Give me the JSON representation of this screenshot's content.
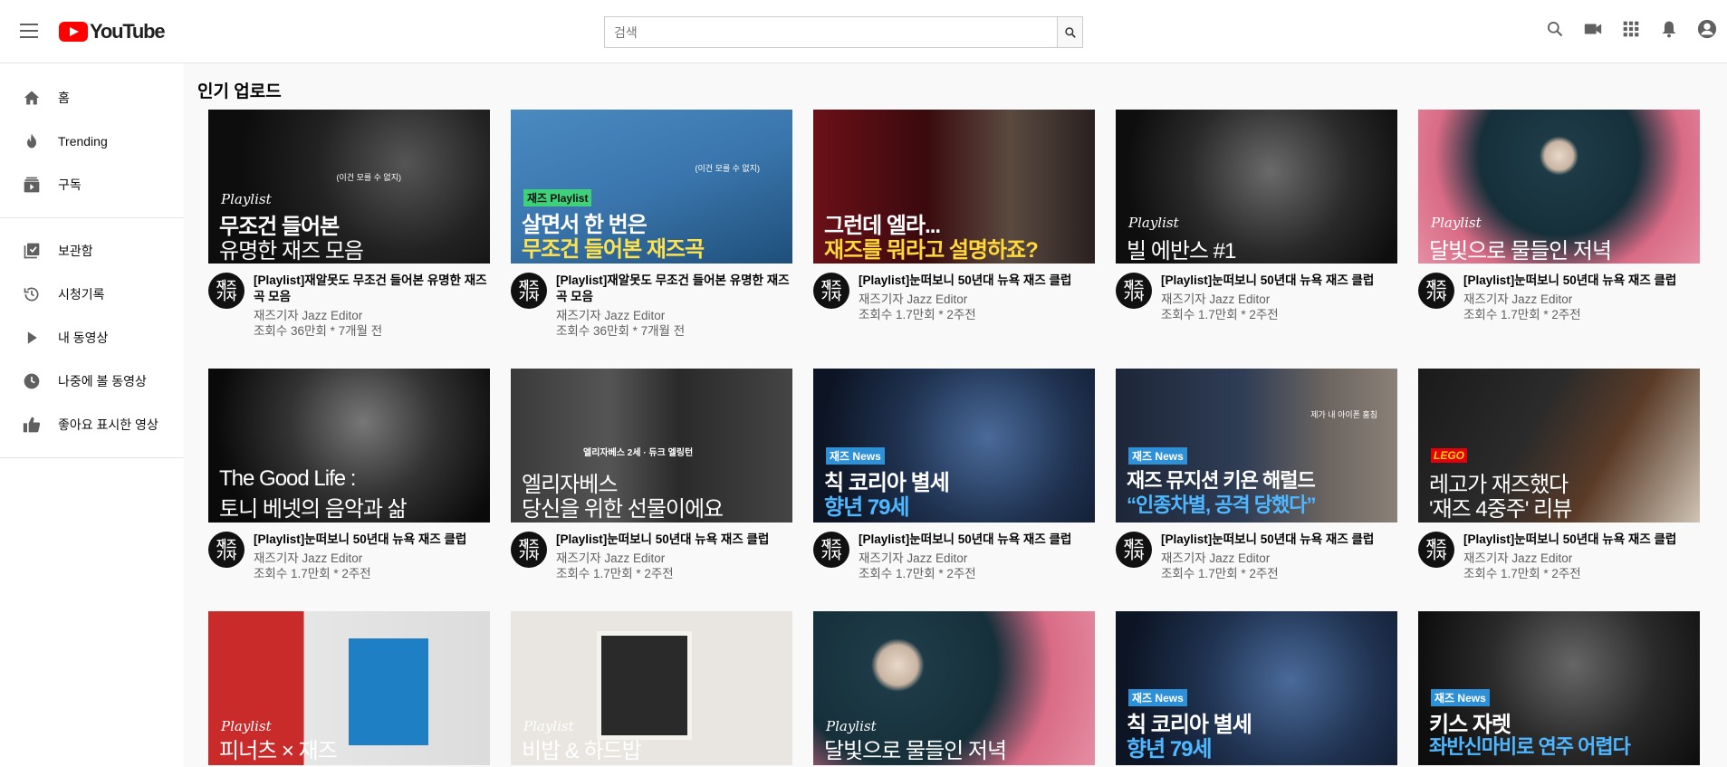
{
  "header": {
    "logo_text": "YouTube",
    "search_placeholder": "검색"
  },
  "sidebar": {
    "items": [
      {
        "label": "홈"
      },
      {
        "label": "Trending"
      },
      {
        "label": "구독"
      },
      {
        "label": "보관함"
      },
      {
        "label": "시청기록"
      },
      {
        "label": "내 동영상"
      },
      {
        "label": "나중에 볼 동영상"
      },
      {
        "label": "좋아요 표시한 영상"
      }
    ]
  },
  "main": {
    "section_title": "인기 업로드",
    "videos": [
      {
        "title": "[Playlist]재알못도 무조건 들어본 유명한 재즈 곡 모음",
        "channel": "재즈기자 Jazz Editor",
        "views": "조회수 36만회 * 7개월 전",
        "thumb_tag": "Playlist",
        "thumb_line1": "무조건 들어본",
        "thumb_line2": "유명한 재즈 모음",
        "thumb_note": "(이건 모를 수 없지)",
        "avatar": "재즈\n기자"
      },
      {
        "title": "[Playlist]재알못도 무조건 들어본 유명한 재즈 곡 모음",
        "channel": "재즈기자 Jazz Editor",
        "views": "조회수 36만회 * 7개월 전",
        "thumb_tag": "재즈 Playlist",
        "thumb_line1": "살면서 한 번은",
        "thumb_line2": "무조건 들어본 재즈곡",
        "thumb_note": "(이건 모를 수 없지)",
        "avatar": "재즈\n기자"
      },
      {
        "title": "[Playlist]눈떠보니 50년대 뉴욕 재즈 클럽",
        "channel": "재즈기자 Jazz Editor",
        "views": "조회수 1.7만회 * 2주전",
        "thumb_line1": "그런데 엘라...",
        "thumb_line2": "재즈를 뭐라고 설명하죠?",
        "avatar": "재즈\n기자"
      },
      {
        "title": "[Playlist]눈떠보니 50년대 뉴욕 재즈 클럽",
        "channel": "재즈기자 Jazz Editor",
        "views": "조회수 1.7만회 * 2주전",
        "thumb_tag": "Playlist",
        "thumb_line1": "빌 에반스 #1",
        "avatar": "재즈\n기자"
      },
      {
        "title": "[Playlist]눈떠보니 50년대 뉴욕 재즈 클럽",
        "channel": "재즈기자 Jazz Editor",
        "views": "조회수 1.7만회 * 2주전",
        "thumb_tag": "Playlist",
        "thumb_line1": "달빛으로 물들인 저녁",
        "avatar": "재즈\n기자"
      },
      {
        "title": "[Playlist]눈떠보니 50년대 뉴욕 재즈 클럽",
        "channel": "재즈기자 Jazz Editor",
        "views": "조회수 1.7만회 * 2주전",
        "thumb_line1": "The Good Life :",
        "thumb_line2": "토니 베넷의 음악과 삶",
        "avatar": "재즈\n기자"
      },
      {
        "title": "[Playlist]눈떠보니 50년대 뉴욕 재즈 클럽",
        "channel": "재즈기자 Jazz Editor",
        "views": "조회수 1.7만회 * 2주전",
        "thumb_line1": "엘리자베스",
        "thumb_line2": "당신을 위한 선물이에요",
        "thumb_note": "엘리자베스 2세 · 듀크 엘링턴",
        "avatar": "재즈\n기자"
      },
      {
        "title": "[Playlist]눈떠보니 50년대 뉴욕 재즈 클럽",
        "channel": "재즈기자 Jazz Editor",
        "views": "조회수 1.7만회 * 2주전",
        "thumb_tag": "재즈 News",
        "thumb_line1": "칙 코리아 별세",
        "thumb_line2": "향년 79세",
        "avatar": "재즈\n기자"
      },
      {
        "title": "[Playlist]눈떠보니 50년대 뉴욕 재즈 클럽",
        "channel": "재즈기자 Jazz Editor",
        "views": "조회수 1.7만회 * 2주전",
        "thumb_tag": "재즈 News",
        "thumb_line1": "재즈 뮤지션 키욘 해럴드",
        "thumb_line2": "“인종차별, 공격 당했다”",
        "thumb_note": "제가 내 아이폰 훔침",
        "avatar": "재즈\n기자"
      },
      {
        "title": "[Playlist]눈떠보니 50년대 뉴욕 재즈 클럽",
        "channel": "재즈기자 Jazz Editor",
        "views": "조회수 1.7만회 * 2주전",
        "thumb_tag": "LEGO",
        "thumb_line1": "레고가 재즈했다",
        "thumb_line2": "'재즈 4중주' 리뷰",
        "avatar": "재즈\n기자"
      },
      {
        "thumb_tag": "Playlist",
        "thumb_line1": "피너츠 × 재즈"
      },
      {
        "thumb_tag": "Playlist",
        "thumb_line1": "비밥 & 하드밥"
      },
      {
        "thumb_tag": "Playlist",
        "thumb_line1": "달빛으로 물들인 저녁"
      },
      {
        "thumb_tag": "재즈 News",
        "thumb_line1": "칙 코리아 별세",
        "thumb_line2": "향년 79세"
      },
      {
        "thumb_tag": "재즈 News",
        "thumb_line1": "키스 자렛",
        "thumb_line2": "좌반신마비로 연주 어렵다"
      }
    ]
  }
}
